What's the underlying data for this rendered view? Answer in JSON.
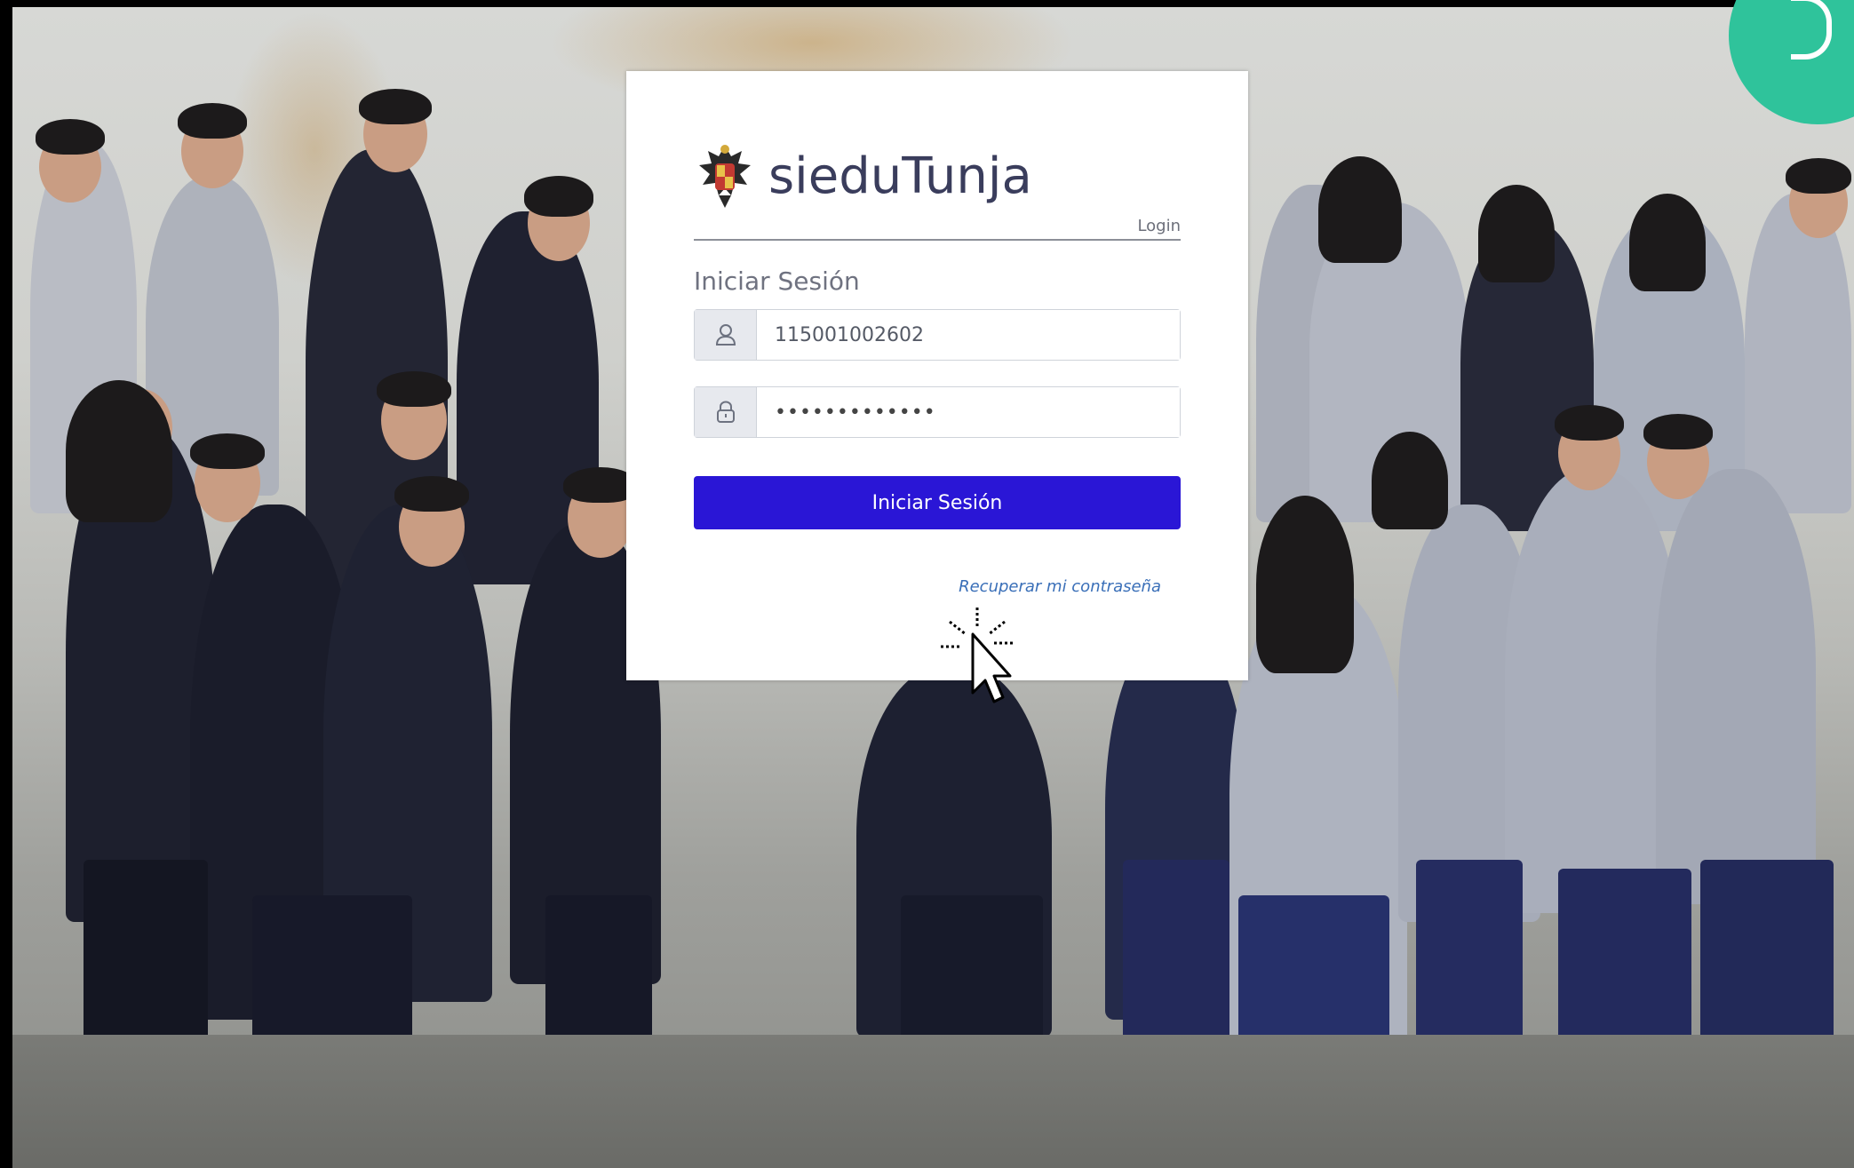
{
  "background": {
    "description_icon": "group-photo-background"
  },
  "brand": {
    "name": "sieduTunja",
    "crest_icon": "coat-of-arms-icon",
    "tag": "Login"
  },
  "form": {
    "title": "Iniciar Sesión",
    "username": {
      "value": "115001002602",
      "icon": "user-icon"
    },
    "password": {
      "value": "•••••••••••••",
      "icon": "lock-icon"
    },
    "submit_label": "Iniciar Sesión",
    "recover_label": "Recuperar mi contraseña"
  },
  "colors": {
    "accent": "#2a16d6",
    "corner": "#2fc39b",
    "link": "#3a6fb8"
  },
  "cursor_icon": "mouse-pointer-click-icon"
}
